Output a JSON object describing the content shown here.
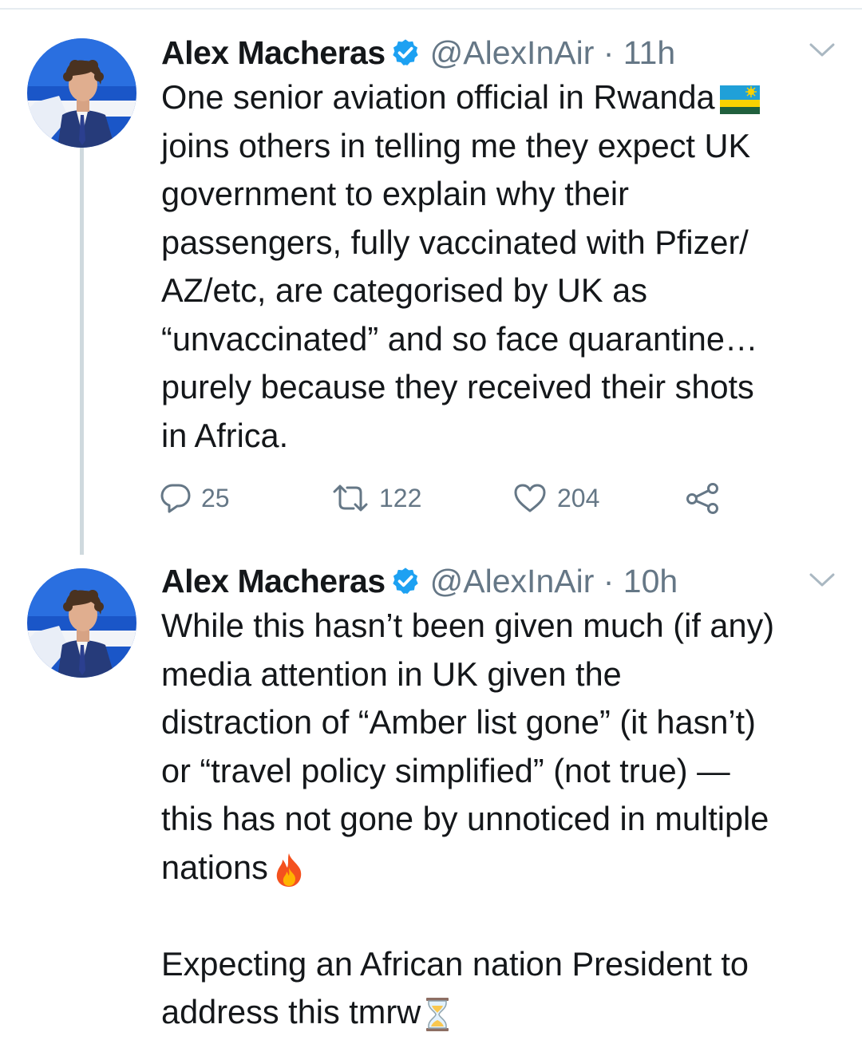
{
  "tweets": [
    {
      "author_name": "Alex Macheras",
      "handle_time": "@AlexInAir · 11h",
      "text_before_emoji": "One senior aviation official in Rwanda",
      "emoji_inline": "rwanda-flag",
      "text_after_emoji": "joins others in telling me they expect UK\ngovernment to explain why their\npassengers, fully vaccinated with Pfizer/\nAZ/etc, are categorised by UK as\n“unvaccinated” and so face quarantine…\npurely because they received their shots\nin Africa.",
      "stats": {
        "replies": "25",
        "retweets": "122",
        "likes": "204"
      }
    },
    {
      "author_name": "Alex Macheras",
      "handle_time": "@AlexInAir · 10h",
      "text_part1": "While this hasn’t been given much (if any)\nmedia attention in UK given the\ndistraction of “Amber list gone” (it hasn’t)\nor “travel policy simplified” (not true) —\nthis has not gone by unnoticed in multiple\nnations",
      "emoji_1": "fire",
      "text_part2": "\n\nExpecting an African nation President to\naddress this tmrw",
      "emoji_2": "hourglass"
    }
  ],
  "icons": {
    "verified": "verified-badge-icon",
    "more": "chevron-down-icon",
    "reply": "reply-icon",
    "retweet": "retweet-icon",
    "like": "heart-icon",
    "share": "share-icon"
  },
  "colors": {
    "text": "#14171a",
    "secondary": "#657786",
    "verified_blue": "#1da1f2",
    "thread_line": "#cfd9de"
  }
}
